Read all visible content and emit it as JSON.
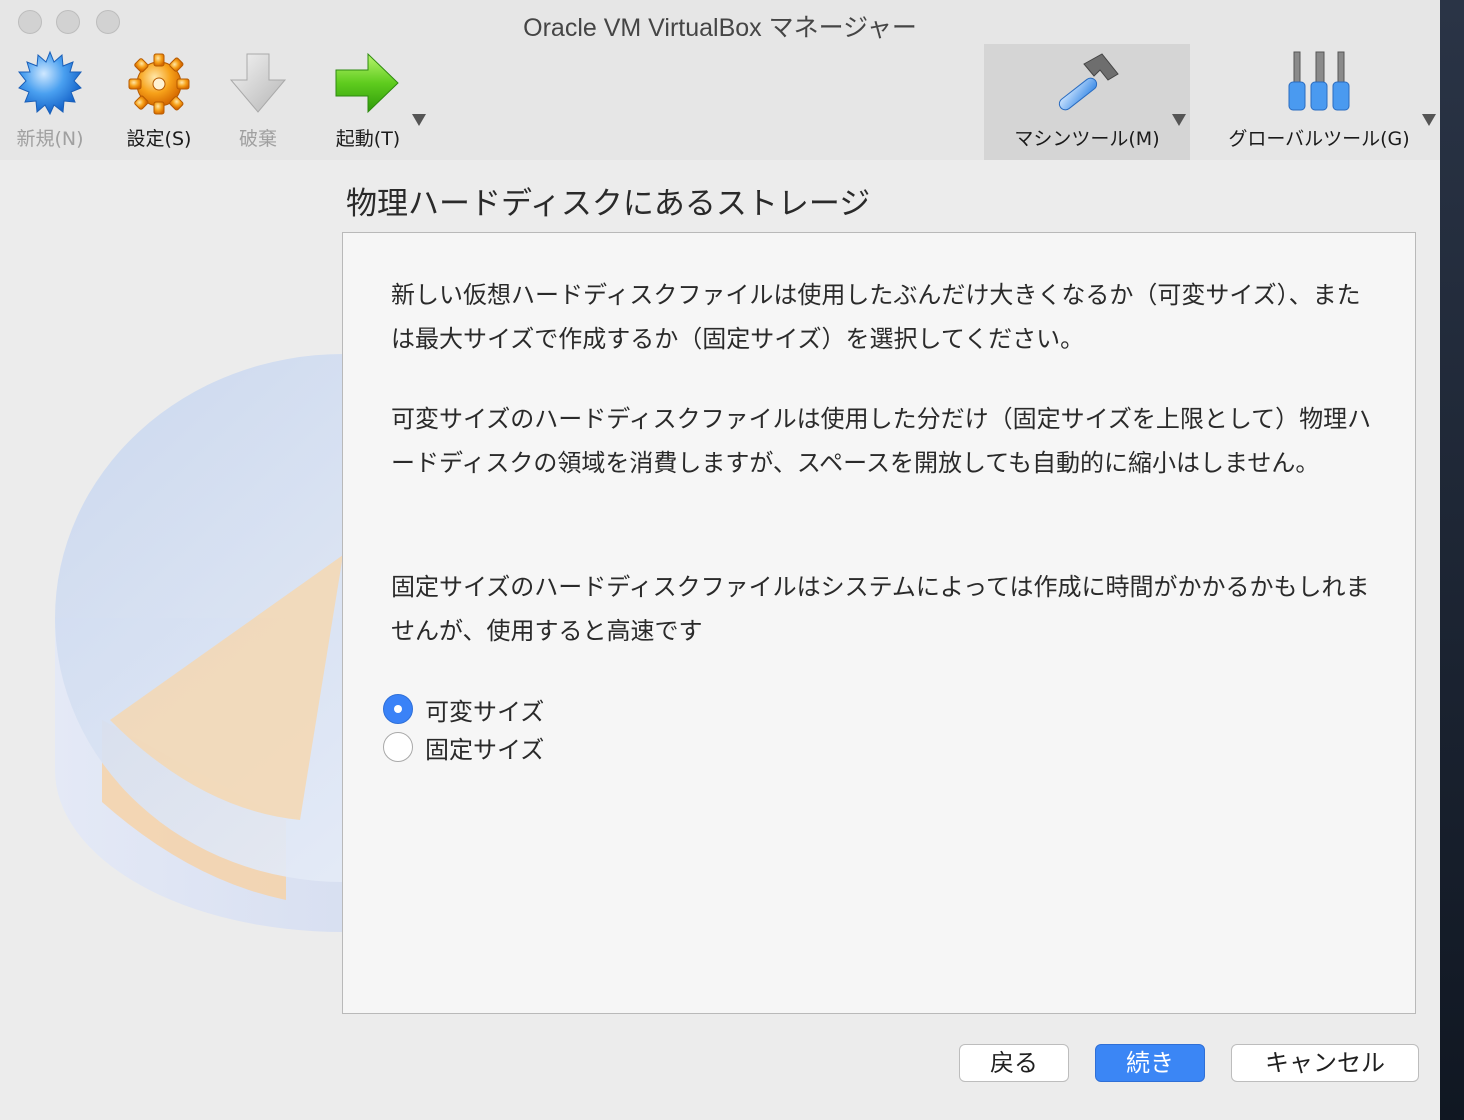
{
  "window": {
    "title": "Oracle VM VirtualBox マネージャー"
  },
  "toolbar": {
    "new_label": "新規(N)",
    "settings_label": "設定(S)",
    "discard_label": "破棄",
    "start_label": "起動(T)",
    "machine_tools_label": "マシンツール(M)",
    "global_tools_label": "グローバルツール(G)"
  },
  "wizard": {
    "heading": "物理ハードディスクにあるストレージ",
    "paragraph1": "新しい仮想ハードディスクファイルは使用したぶんだけ大きくなるか（可変サイズ）、または最大サイズで作成するか（固定サイズ）を選択してください。",
    "paragraph2": "可変サイズのハードディスクファイルは使用した分だけ（固定サイズを上限として）物理ハードディスクの領域を消費しますが、スペースを開放しても自動的に縮小はしません。",
    "paragraph3": "固定サイズのハードディスクファイルはシステムによっては作成に時間がかかるかもしれませんが、使用すると高速です",
    "options": [
      {
        "label": "可変サイズ",
        "selected": true
      },
      {
        "label": "固定サイズ",
        "selected": false
      }
    ],
    "back_label": "戻る",
    "next_label": "続き",
    "cancel_label": "キャンセル"
  },
  "colors": {
    "accent": "#3b86f5"
  }
}
